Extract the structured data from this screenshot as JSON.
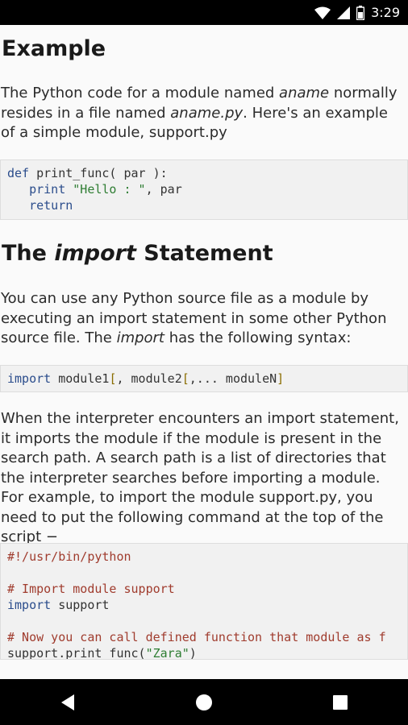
{
  "status_bar": {
    "time": "3:29"
  },
  "sections": {
    "example_heading": "Example",
    "example_para": {
      "part1": "The Python code for a module named ",
      "em1": "aname",
      "part2": " normally resides in a file named ",
      "em2": "aname.py",
      "part3": ". Here's an example of a simple module, support.py"
    },
    "code1": {
      "line1_kw": "def",
      "line1_rest": " print_func( par ):",
      "line2_indent": "   ",
      "line2_kw": "print",
      "line2_str": " \"Hello : \"",
      "line2_rest": ", par",
      "line3_indent": "   ",
      "line3_kw": "return"
    },
    "import_heading": {
      "pre": "The ",
      "em": "import",
      "post": " Statement"
    },
    "import_para": {
      "part1": "You can use any Python source file as a module by executing an import statement in some other Python source file. The ",
      "em": "import",
      "part2": " has the following syntax:"
    },
    "code2": {
      "kw": "import",
      "rest1": " module1",
      "pun1": "[",
      "rest2": ", module2",
      "pun2": "[",
      "rest3": ",... moduleN",
      "pun3": "]"
    },
    "interpreter_para": "When the interpreter encounters an import statement, it imports the module if the module is present in the search path. A search path is a list of directories that the interpreter searches before importing a module. For example, to import the module support.py, you need to put the following command at the top of the script −",
    "code3": {
      "line1": "#!/usr/bin/python",
      "line3": "# Import module support",
      "line4_kw": "import",
      "line4_rest": " support",
      "line6": "# Now you can call defined function that module as f",
      "line7_pre": "support.print_func(",
      "line7_str": "\"Zara\"",
      "line7_post": ")"
    }
  },
  "nav_bar": {
    "back": "back-icon",
    "home": "home-icon",
    "recents": "recents-icon"
  }
}
